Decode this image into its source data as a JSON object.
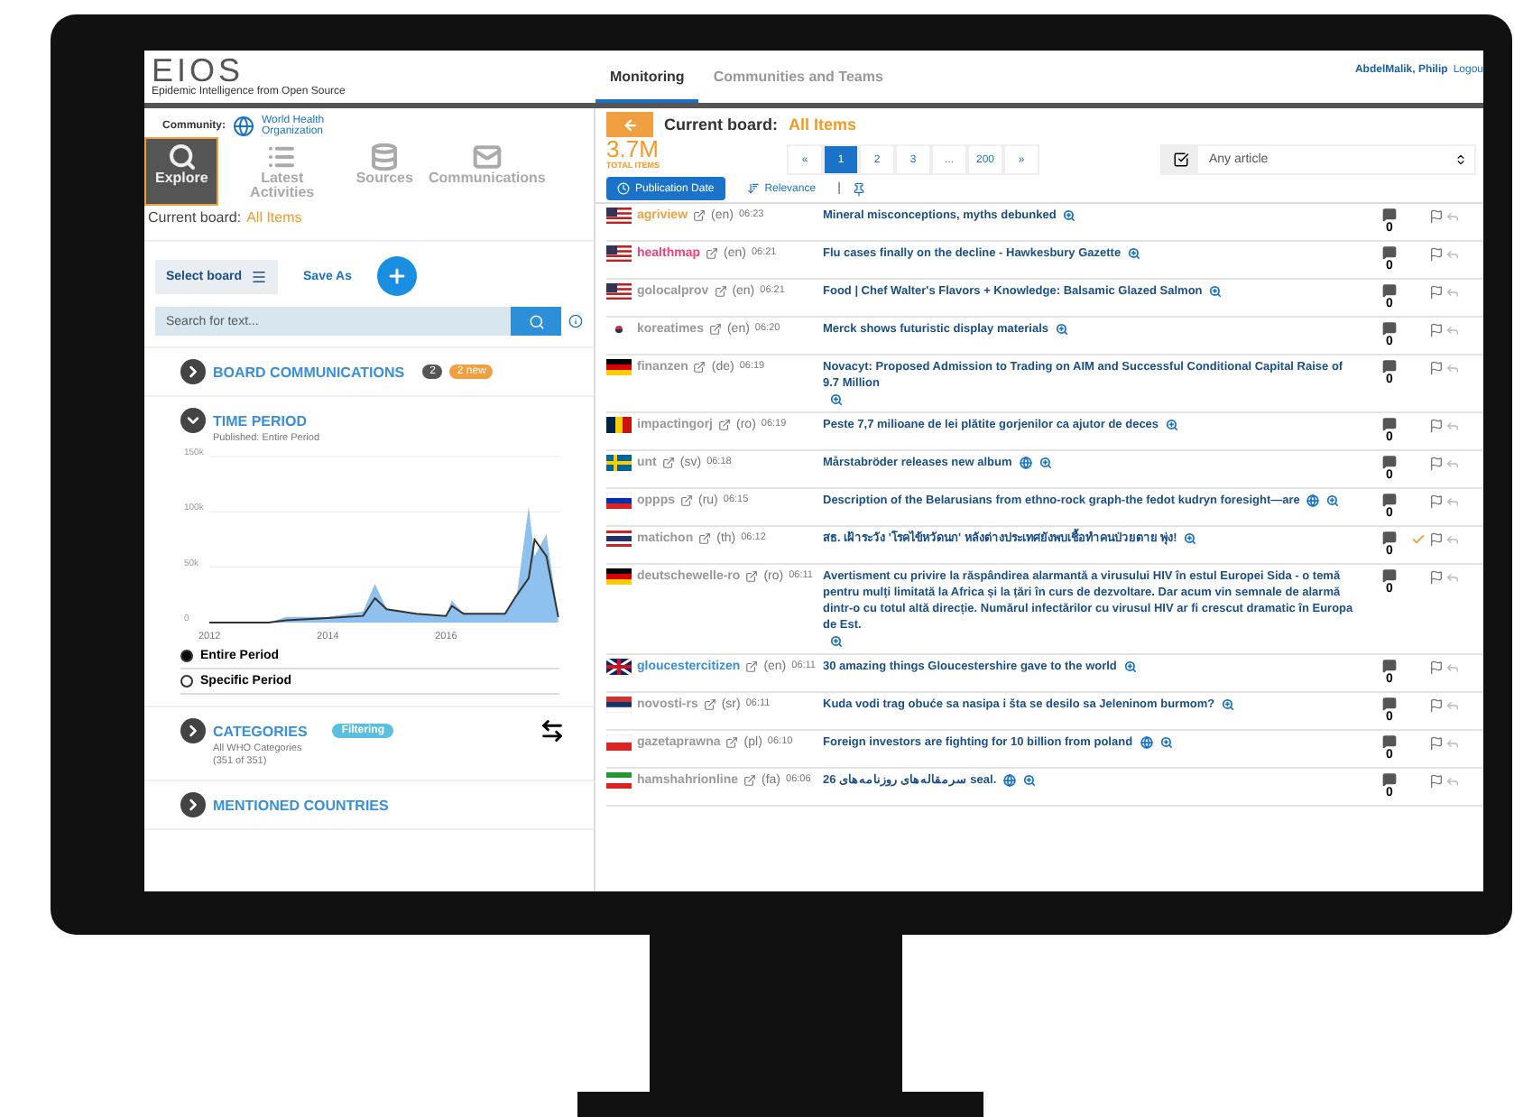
{
  "app": {
    "logo": "EIOS",
    "tagline": "Epidemic Intelligence from Open Source"
  },
  "nav": [
    {
      "label": "Monitoring",
      "selected": true
    },
    {
      "label": "Communities and Teams",
      "selected": false
    }
  ],
  "user": {
    "name": "AbdelMalik, Philip",
    "logout": "Logou"
  },
  "sidebar": {
    "community_label": "Community:",
    "organization": "World Health Organization",
    "tabs": [
      {
        "label": "Explore",
        "kind": "search",
        "selected": true
      },
      {
        "label": "Latest Activities",
        "kind": "list",
        "selected": false
      },
      {
        "label": "Sources",
        "kind": "database",
        "selected": false
      },
      {
        "label": "Communications",
        "kind": "mail",
        "selected": false
      }
    ],
    "current_board_label": "Current board:",
    "current_board": "All Items",
    "select_board": "Select board",
    "save_as": "Save As",
    "search": {
      "placeholder": "Search for text..."
    },
    "board_communications": {
      "title": "BOARD COMMUNICATIONS",
      "count": "2",
      "new_badge": "2 new",
      "expanded": false
    },
    "time_period": {
      "title": "TIME PERIOD",
      "expanded": true,
      "subtitle": "Published: Entire Period",
      "chart_data": {
        "type": "area",
        "x": [
          2012,
          2013,
          2013.3,
          2014,
          2014.6,
          2014.8,
          2015,
          2015.5,
          2016,
          2016.1,
          2016.3,
          2017,
          2017.2,
          2017.4,
          2017.5,
          2017.7,
          2017.9
        ],
        "series": [
          {
            "type": "area",
            "color": "#8fc1ef",
            "values": [
              0,
              0,
              5,
              5,
              10,
              35,
              12,
              8,
              6,
              20,
              8,
              8,
              25,
              105,
              60,
              80,
              5
            ]
          },
          {
            "type": "line",
            "color": "#333333",
            "values": [
              0,
              0,
              2,
              4,
              6,
              22,
              12,
              8,
              6,
              15,
              8,
              8,
              25,
              40,
              75,
              60,
              5
            ]
          }
        ],
        "xlim": [
          2012,
          2017.95
        ],
        "ylim": [
          0,
          150
        ],
        "xticks": [
          2012,
          2014,
          2016
        ],
        "yticks": [
          {
            "value": 0,
            "label": "0"
          },
          {
            "value": 50,
            "label": "50k"
          },
          {
            "value": 100,
            "label": "100k"
          },
          {
            "value": 150,
            "label": "150k"
          }
        ]
      },
      "options": [
        {
          "label": "Entire Period",
          "selected": true
        },
        {
          "label": "Specific Period",
          "selected": false
        }
      ]
    },
    "categories": {
      "title": "CATEGORIES",
      "badge": "Filtering",
      "expanded": false,
      "line1": "All WHO Categories",
      "line2": "(351 of 351)"
    },
    "countries": {
      "title": "MENTIONED COUNTRIES",
      "expanded": false
    }
  },
  "board": {
    "label": "Current board:",
    "name": "All Items",
    "total": "3.7M",
    "total_label": "TOTAL ITEMS",
    "pages": [
      {
        "label": "«",
        "selected": false
      },
      {
        "label": "1",
        "selected": true
      },
      {
        "label": "2",
        "selected": false
      },
      {
        "label": "3",
        "selected": false
      },
      {
        "label": "...",
        "selected": false
      },
      {
        "label": "200",
        "selected": false
      },
      {
        "label": "»",
        "selected": false
      }
    ],
    "filter": "Any article",
    "sort": [
      {
        "label": "Publication Date",
        "kind": "clock",
        "selected": true
      },
      {
        "label": "Relevance",
        "kind": "bars",
        "selected": false
      }
    ],
    "sort_separator": "|"
  },
  "articles": [
    {
      "kind": "us",
      "source": "agriview",
      "color": "#f0a040",
      "lang": "(en)",
      "time": "06:23",
      "title": "Mineral misconceptions, myths debunked",
      "globe": false,
      "checked": false,
      "comments": "0"
    },
    {
      "kind": "us",
      "source": "healthmap",
      "color": "#e8457a",
      "lang": "(en)",
      "time": "06:21",
      "title": "Flu cases finally on the decline - Hawkesbury Gazette",
      "globe": false,
      "checked": false,
      "comments": "0"
    },
    {
      "kind": "us",
      "source": "golocalprov",
      "color": "#999999",
      "lang": "(en)",
      "time": "06:21",
      "title": "Food | Chef Walter's Flavors + Knowledge: Balsamic Glazed Salmon",
      "globe": false,
      "checked": false,
      "comments": "0"
    },
    {
      "kind": "kr",
      "source": "koreatimes",
      "color": "#999999",
      "lang": "(en)",
      "time": "06:20",
      "title": "Merck shows futuristic display materials",
      "globe": false,
      "checked": false,
      "comments": "0"
    },
    {
      "kind": "de",
      "source": "finanzen",
      "color": "#999999",
      "lang": "(de)",
      "time": "06:19",
      "title": "Novacyt: Proposed Admission to Trading on AIM and Successful Conditional Capital Raise of 9.7 Million",
      "globe": false,
      "checked": false,
      "comments": "0"
    },
    {
      "kind": "ro",
      "source": "impactingorj",
      "color": "#999999",
      "lang": "(ro)",
      "time": "06:19",
      "title": "Peste 7,7 milioane de lei plătite gorjenilor ca ajutor de deces",
      "globe": false,
      "checked": false,
      "comments": "0"
    },
    {
      "kind": "se",
      "source": "unt",
      "color": "#999999",
      "lang": "(sv)",
      "time": "06:18",
      "title": "Mårstabröder releases new album",
      "globe": true,
      "checked": false,
      "comments": "0"
    },
    {
      "kind": "ru",
      "source": "oppps",
      "color": "#999999",
      "lang": "(ru)",
      "time": "06:15",
      "title": "Description of the Belarusians from ethno-rock graph-the fedot kudryn foresight—are",
      "globe": true,
      "checked": false,
      "comments": "0"
    },
    {
      "kind": "th",
      "source": "matichon",
      "color": "#999999",
      "lang": "(th)",
      "time": "06:12",
      "title": "สธ. เฝ้าระวัง 'โรคไข้หวัดนก' หลังต่างประเทศยังพบเชื้อทำคนป่วยตาย พุ่ง!",
      "globe": false,
      "checked": true,
      "comments": "0"
    },
    {
      "kind": "de",
      "source": "deutschewelle-ro",
      "color": "#999999",
      "lang": "(ro)",
      "time": "06:11",
      "title": "Avertisment cu privire la răspândirea alarmantă a virusului HIV în estul Europei Sida - o temă pentru mulți limitată la Africa și la țări în curs de dezvoltare. Dar acum vin semnale de alarmă dintr-o cu totul altă direcție. Numărul infectărilor cu virusul HIV ar fi crescut dramatic în Europa de Est.",
      "globe": false,
      "checked": false,
      "comments": "0"
    },
    {
      "kind": "gb",
      "source": "gloucestercitizen",
      "color": "#3a8fd8",
      "lang": "(en)",
      "time": "06:11",
      "title": "30 amazing things Gloucestershire gave to the world",
      "globe": false,
      "checked": false,
      "comments": "0"
    },
    {
      "kind": "rs",
      "source": "novosti-rs",
      "color": "#999999",
      "lang": "(sr)",
      "time": "06:11",
      "title": "Kuda vodi trag obuće sa nasipa i šta se desilo sa Jeleninom burmom?",
      "globe": false,
      "checked": false,
      "comments": "0"
    },
    {
      "kind": "pl",
      "source": "gazetaprawna",
      "color": "#999999",
      "lang": "(pl)",
      "time": "06:10",
      "title": "Foreign investors are fighting for 10 billion from poland",
      "globe": true,
      "checked": false,
      "comments": "0"
    },
    {
      "kind": "ir",
      "source": "hamshahrionline",
      "color": "#999999",
      "lang": "(fa)",
      "time": "06:06",
      "title": "26 سرمقاله‌های روزنامه‌های seal.",
      "globe": true,
      "checked": false,
      "comments": "0"
    }
  ]
}
